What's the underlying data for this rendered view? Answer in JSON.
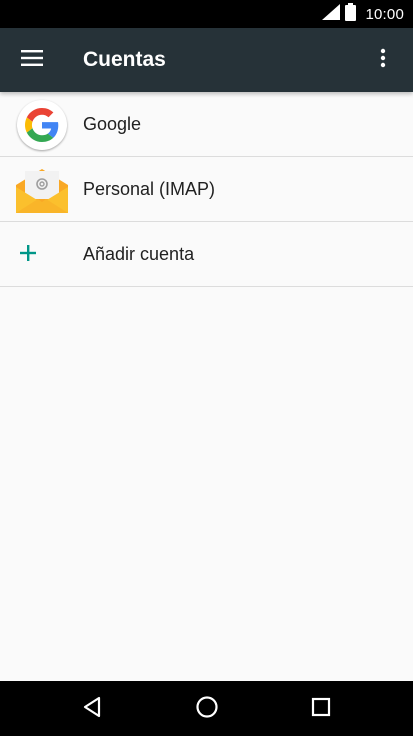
{
  "status_bar": {
    "time": "10:00",
    "icons": [
      "signal-icon",
      "battery-icon"
    ]
  },
  "app_bar": {
    "title": "Cuentas",
    "menu_icon": "hamburger-menu-icon",
    "overflow_icon": "more-vert-icon"
  },
  "accounts": [
    {
      "label": "Google",
      "icon": "google-logo-icon"
    },
    {
      "label": "Personal (IMAP)",
      "icon": "email-envelope-icon"
    }
  ],
  "add_account": {
    "label": "Añadir cuenta",
    "icon": "plus-icon",
    "icon_color": "#009688"
  },
  "nav_bar": {
    "buttons": [
      "back-icon",
      "home-icon",
      "recents-icon"
    ]
  },
  "colors": {
    "app_bar": "#263238",
    "status_bar": "#000000",
    "background": "#fafafa",
    "accent": "#009688"
  }
}
